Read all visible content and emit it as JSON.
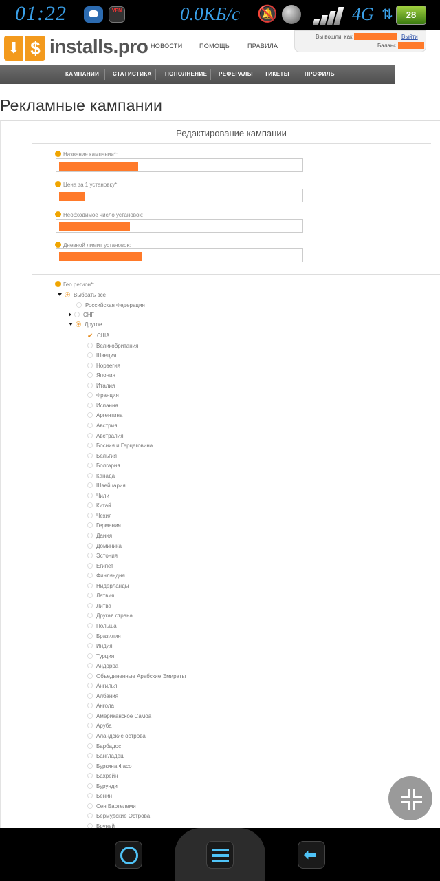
{
  "status_bar": {
    "time": "01:22",
    "vpn_label": "VPN",
    "net_speed": "0.0КБ/с",
    "network": "4G",
    "battery": "28"
  },
  "header": {
    "logo_text": "installs.pro",
    "nav": [
      "НОВОСТИ",
      "ПОМОЩЬ",
      "ПРАВИЛА"
    ],
    "logged_in_as": "Вы вошли, как",
    "logout": "Выйти",
    "balance": "Баланс:"
  },
  "main_nav": [
    "КАМПАНИИ",
    "СТАТИСТИКА",
    "ПОПОЛНЕНИЕ",
    "РЕФЕРАЛЫ",
    "ТИКЕТЫ",
    "ПРОФИЛЬ"
  ],
  "page_title": "Рекламные кампании",
  "form": {
    "title": "Редактирование кампании",
    "fields": [
      {
        "label": "Название кампании*:"
      },
      {
        "label": "Цена за 1 установку*:"
      },
      {
        "label": "Необходимое число установок:"
      },
      {
        "label": "Дневной лимит установок:"
      }
    ],
    "geo_label": "Гео регион*:",
    "geo_tree": {
      "select_all": "Выбрать всё",
      "groups": [
        "Российская Федерация",
        "СНГ",
        "Другое"
      ],
      "countries": [
        "США",
        "Великобритания",
        "Швеция",
        "Норвегия",
        "Япония",
        "Италия",
        "Франция",
        "Испания",
        "Аргентина",
        "Австрия",
        "Австралия",
        "Босния и Герцеговина",
        "Бельгия",
        "Болгария",
        "Канада",
        "Швейцария",
        "Чили",
        "Китай",
        "Чехия",
        "Германия",
        "Дания",
        "Доминика",
        "Эстония",
        "Египет",
        "Финляндия",
        "Нидерланды",
        "Латвия",
        "Литва",
        "Другая страна",
        "Польша",
        "Бразилия",
        "Индия",
        "Турция",
        "Андорра",
        "Объединенные Арабские Эмираты",
        "Ангилья",
        "Албания",
        "Ангола",
        "Американское Самоа",
        "Аруба",
        "Аландские острова",
        "Барбадос",
        "Бангладеш",
        "Буркина Фасо",
        "Бахрейн",
        "Бурунди",
        "Бенин",
        "Сен Бартелеми",
        "Бермудские Острова",
        "Бруней"
      ],
      "checked_country": "США"
    }
  }
}
